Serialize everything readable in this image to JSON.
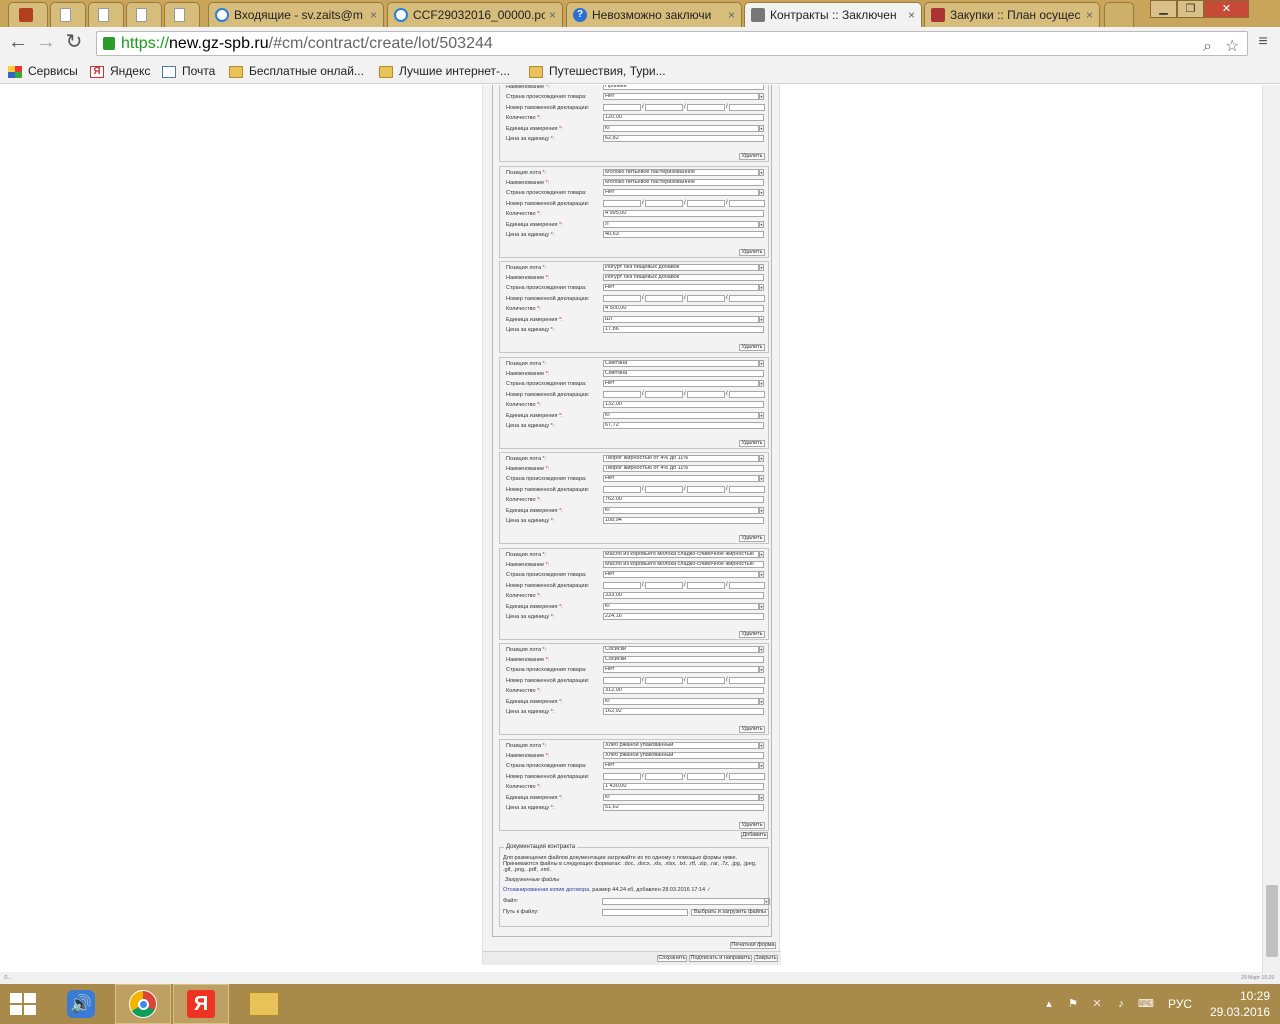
{
  "browser": {
    "tabs": [
      {
        "title": "",
        "icon": "hamburger-icon"
      },
      {
        "title": "",
        "icon": "page-icon"
      },
      {
        "title": "",
        "icon": "page-icon"
      },
      {
        "title": "",
        "icon": "page-icon"
      },
      {
        "title": "",
        "icon": "page-icon"
      },
      {
        "title": "Входящие - sv.zaits@m",
        "icon": "mail-icon"
      },
      {
        "title": "CCF29032016_00000.pc",
        "icon": "mail-icon"
      },
      {
        "title": "Невозможно заключи",
        "icon": "help-icon"
      },
      {
        "title": "Контракты :: Заключен",
        "icon": "hammer-icon",
        "active": true
      },
      {
        "title": "Закупки :: План осущес",
        "icon": "hammer-icon"
      }
    ],
    "tab_close": "×",
    "url": {
      "scheme": "https://",
      "host": "new.gz-spb.ru",
      "path": "/#cm/contract/create/lot/503244"
    },
    "bookmarks": [
      {
        "label": "Сервисы",
        "icon": "apps-icon"
      },
      {
        "label": "Яндекс",
        "icon": "yandex-icon"
      },
      {
        "label": "Почта",
        "icon": "mail-icon"
      },
      {
        "label": "Бесплатные онлай...",
        "icon": "folder-icon"
      },
      {
        "label": "Лучшие интернет-...",
        "icon": "folder-icon"
      },
      {
        "label": "Путешествия, Тури...",
        "icon": "folder-icon"
      }
    ]
  },
  "form": {
    "labels": {
      "position": "Позиция лота",
      "name": "Наименование",
      "country": "Страна происхождения товара:",
      "customs": "Номер таможенной декларации:",
      "qty": "Количество",
      "unit": "Единица измерения",
      "price": "Цена за единицу",
      "req": "*",
      "colon": ":",
      "delete": "Удалить",
      "slash": "/"
    },
    "lots": [
      {
        "position": "",
        "name": "Пряники",
        "country": "Нет",
        "qty": "120,00",
        "unit": "КГ",
        "price": "62,82"
      },
      {
        "position": "Молоко питьевое пастеризованное",
        "name": "Молоко питьевое пастеризованное",
        "country": "Нет",
        "qty": "4 995,00",
        "unit": "Л",
        "price": "40,63"
      },
      {
        "position": "Йогурт без пищевых добавок",
        "name": "Йогурт без пищевых добавок",
        "country": "Нет",
        "qty": "4 500,00",
        "unit": "ШТ",
        "price": "17,86"
      },
      {
        "position": "Сметана",
        "name": "Сметана",
        "country": "Нет",
        "qty": "132,00",
        "unit": "КГ",
        "price": "67,72"
      },
      {
        "position": "Творог жирностью от 4% до 11%",
        "name": "Творог жирностью от 4% до 11%",
        "country": "Нет",
        "qty": "762,00",
        "unit": "КГ",
        "price": "108,94"
      },
      {
        "position": "Масло из коровьего молока сладко-сливочное жирностью",
        "name": "Масло из коровьего молока сладко-сливочное жирностью",
        "country": "Нет",
        "qty": "333,00",
        "unit": "КГ",
        "price": "224,16"
      },
      {
        "position": "Сосиски",
        "name": "Сосиски",
        "country": "Нет",
        "qty": "312,00",
        "unit": "КГ",
        "price": "162,92"
      },
      {
        "position": "Хлеб ржаной упакованный",
        "name": "Хлеб ржаной упакованный",
        "country": "Нет",
        "qty": "1 430,00",
        "unit": "КГ",
        "price": "51,62"
      }
    ],
    "add_label": "Добавить",
    "docs": {
      "legend": "Документация контракта",
      "hint": "Для размещения файлов документации загружайте их по одному с помощью формы ниже. Принимаются файлы в следующих форматах: .doc, .docx, .xls, .xlsx, .txt, .rtf, .zip, .rar, .7z, .jpg, .jpeg, .gif, .png, .pdf, .xml.",
      "uploaded_title": "Загруженные файлы",
      "file_link": "Отсканированная копия договора",
      "file_meta": ", размер 44.24 кб, добавлен 28.03.2016 17:14",
      "file_ok": "✓",
      "file_label": "Файл:",
      "path_label": "Путь к файлу:",
      "upload_button": "Выбрать и загрузить файлы"
    },
    "print_label": "Печатная форма",
    "footer_buttons": {
      "save": "Сохранить",
      "sign_send": "Подписать и направить",
      "close": "Закрыть"
    }
  },
  "status_left": "©...",
  "status_right": "29 Март 10:29",
  "taskbar": {
    "apps": [
      {
        "name": "volume-app"
      },
      {
        "name": "chrome-app"
      },
      {
        "name": "yandex-app"
      },
      {
        "name": "explorer-app"
      }
    ],
    "lang": "РУС",
    "time": "10:29",
    "date": "29.03.2016"
  }
}
